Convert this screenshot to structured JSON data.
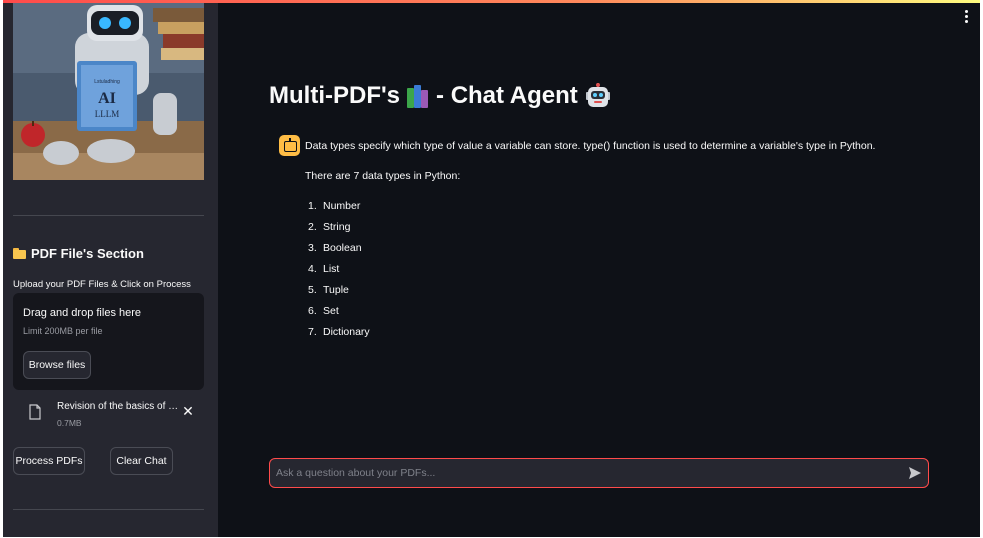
{
  "sidebar": {
    "hero_image": {
      "book_title": "AI",
      "book_subtitle": "LLLM",
      "book_header": "Lstuladhing"
    },
    "section_title": "PDF File's Section",
    "section_icon": "folder-icon",
    "upload_label": "Upload your PDF Files & Click on Process",
    "dropzone": {
      "title": "Drag and drop files here",
      "limit": "Limit 200MB per file",
      "browse_label": "Browse files"
    },
    "uploaded_file": {
      "name": "Revision of the basics of python.pdf",
      "size": "0.7MB"
    },
    "process_label": "Process PDFs",
    "clear_label": "Clear Chat"
  },
  "main": {
    "title_part1": "Multi-PDF's",
    "title_part2": "- Chat Agent",
    "title_icons": [
      "books-icon",
      "robot-face-icon"
    ],
    "message": {
      "avatar_icon": "robot-icon",
      "line1": "Data types specify which type of value a variable can store. type() function is used to determine a variable's type in Python.",
      "line2": "There are 7 data types in Python:",
      "items": [
        {
          "num": "1.",
          "text": "Number"
        },
        {
          "num": "2.",
          "text": "String"
        },
        {
          "num": "3.",
          "text": "Boolean"
        },
        {
          "num": "4.",
          "text": "List"
        },
        {
          "num": "5.",
          "text": "Tuple"
        },
        {
          "num": "6.",
          "text": "Set"
        },
        {
          "num": "7.",
          "text": "Dictionary"
        }
      ]
    },
    "chat_input": {
      "placeholder": "Ask a question about your PDFs...",
      "value": ""
    }
  },
  "colors": {
    "background": "#0e1117",
    "sidebar": "#262730",
    "accent": "#ff4b4b",
    "avatar": "#ffbd45"
  }
}
